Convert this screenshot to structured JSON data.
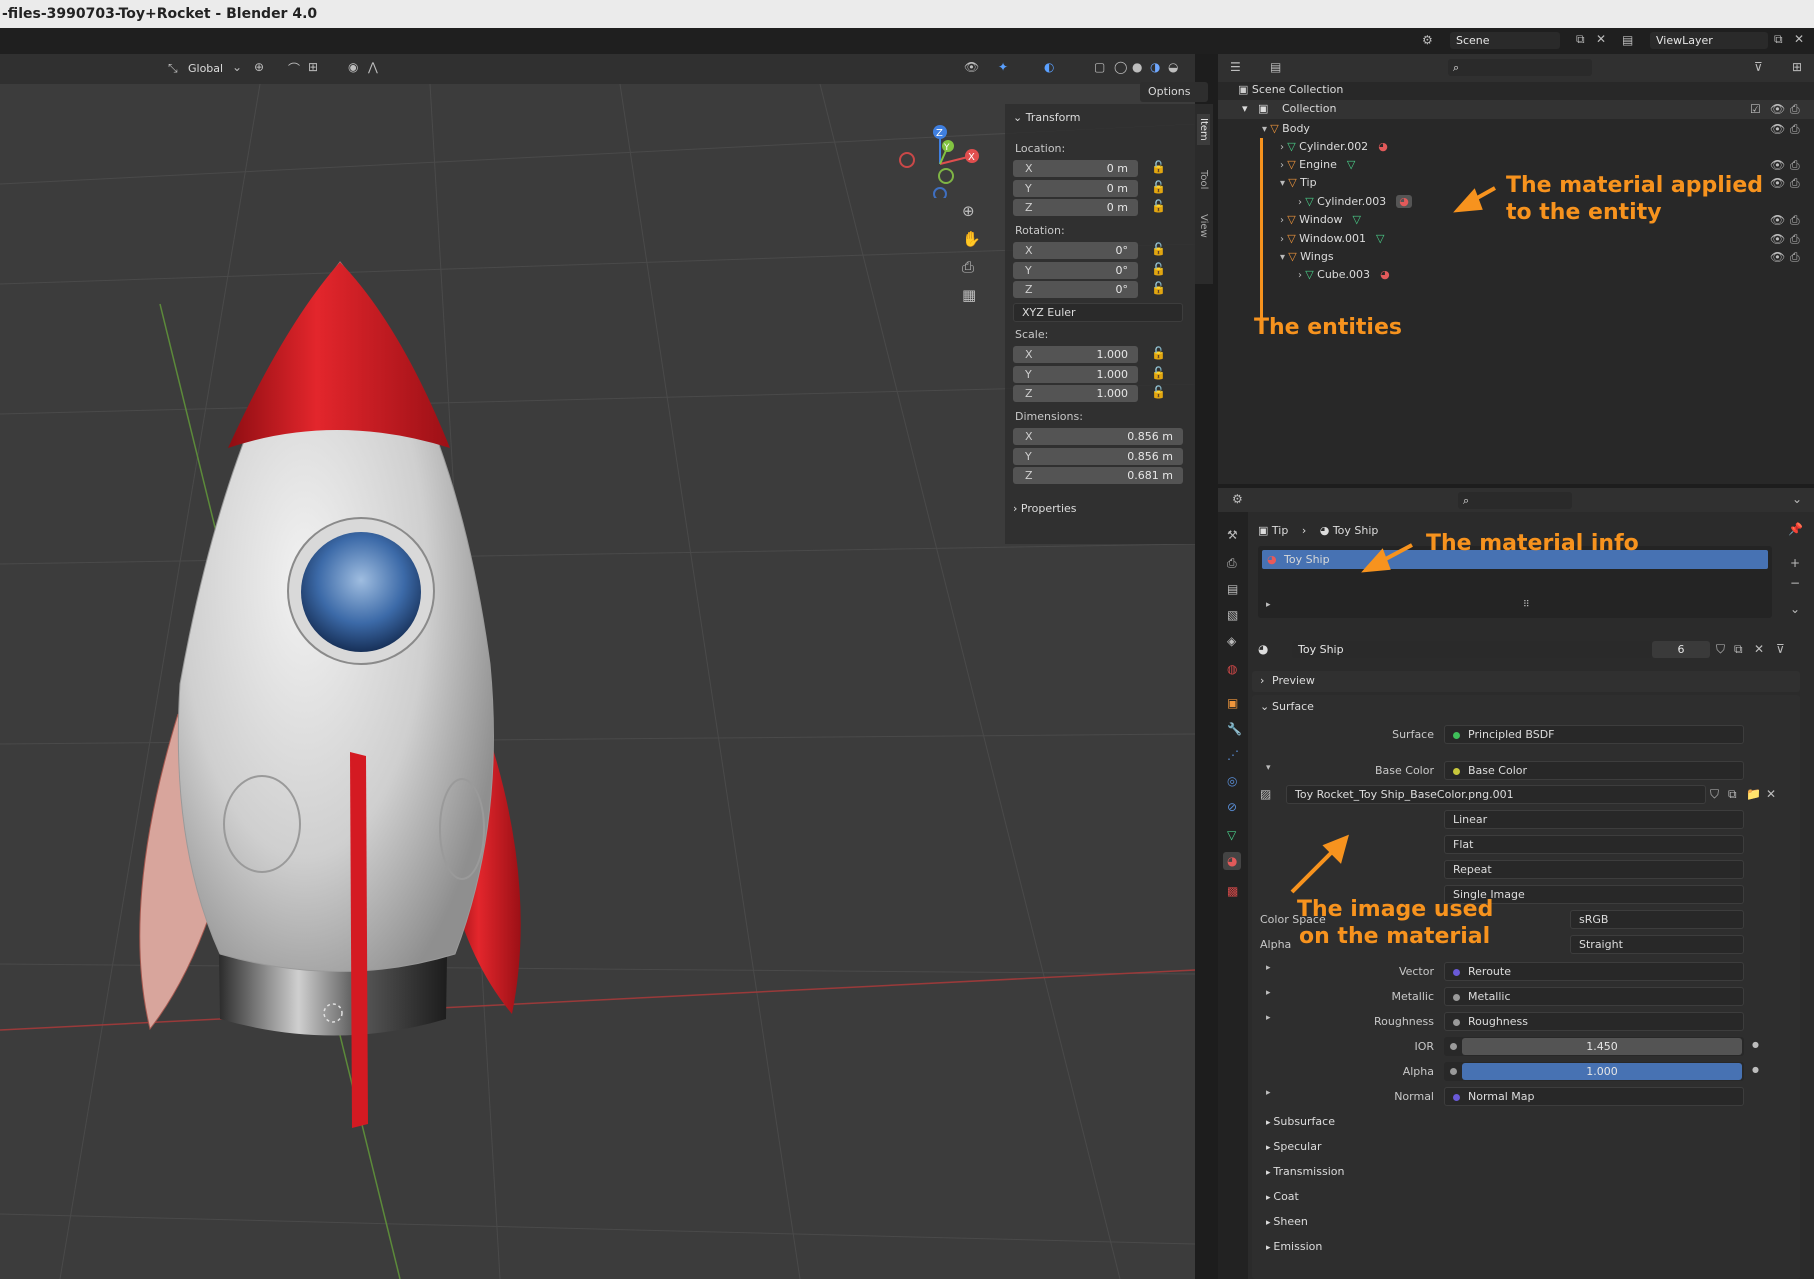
{
  "window": {
    "title": "-files-3990703-Toy+Rocket - Blender 4.0"
  },
  "topbar": {
    "scene_label": "Scene",
    "viewlayer_label": "ViewLayer"
  },
  "viewport_header": {
    "orientation": "Global",
    "options_label": "Options"
  },
  "transform_panel": {
    "title": "Transform",
    "location_label": "Location:",
    "location": [
      {
        "axis": "X",
        "value": "0 m"
      },
      {
        "axis": "Y",
        "value": "0 m"
      },
      {
        "axis": "Z",
        "value": "0 m"
      }
    ],
    "rotation_label": "Rotation:",
    "rotation": [
      {
        "axis": "X",
        "value": "0°"
      },
      {
        "axis": "Y",
        "value": "0°"
      },
      {
        "axis": "Z",
        "value": "0°"
      }
    ],
    "rotation_mode": "XYZ Euler",
    "scale_label": "Scale:",
    "scale": [
      {
        "axis": "X",
        "value": "1.000"
      },
      {
        "axis": "Y",
        "value": "1.000"
      },
      {
        "axis": "Z",
        "value": "1.000"
      }
    ],
    "dimensions_label": "Dimensions:",
    "dimensions": [
      {
        "axis": "X",
        "value": "0.856 m"
      },
      {
        "axis": "Y",
        "value": "0.856 m"
      },
      {
        "axis": "Z",
        "value": "0.681 m"
      }
    ],
    "properties_label": "Properties"
  },
  "side_tabs": [
    "Item",
    "Tool",
    "View"
  ],
  "outliner": {
    "scene_collection": "Scene Collection",
    "collection": "Collection",
    "items": [
      {
        "name": "Body",
        "kind": "object"
      },
      {
        "name": "Cylinder.002",
        "kind": "mesh"
      },
      {
        "name": "Engine",
        "kind": "object"
      },
      {
        "name": "Tip",
        "kind": "object"
      },
      {
        "name": "Cylinder.003",
        "kind": "mesh"
      },
      {
        "name": "Window",
        "kind": "object"
      },
      {
        "name": "Window.001",
        "kind": "object"
      },
      {
        "name": "Wings",
        "kind": "object"
      },
      {
        "name": "Cube.003",
        "kind": "mesh"
      }
    ]
  },
  "properties": {
    "breadcrumb_object": "Tip",
    "breadcrumb_material": "Toy Ship",
    "material_slot": "Toy Ship",
    "material_name": "Toy Ship",
    "user_count": "6",
    "preview_label": "Preview",
    "surface_header": "Surface",
    "surface_label": "Surface",
    "surface_value": "Principled BSDF",
    "base_color_label": "Base Color",
    "base_color_value": "Base Color",
    "image_name": "Toy Rocket_Toy Ship_BaseColor.png.001",
    "interpolation": "Linear",
    "projection": "Flat",
    "extension": "Repeat",
    "source": "Single Image",
    "color_space_label": "Color Space",
    "color_space_value": "sRGB",
    "alpha_label": "Alpha",
    "alpha_value": "Straight",
    "inputs": [
      {
        "label": "Vector",
        "value": "Reroute"
      },
      {
        "label": "Metallic",
        "value": "Metallic"
      },
      {
        "label": "Roughness",
        "value": "Roughness"
      }
    ],
    "ior_label": "IOR",
    "ior_value": "1.450",
    "alpha_in_label": "Alpha",
    "alpha_in_value": "1.000",
    "normal_label": "Normal",
    "normal_value": "Normal Map",
    "sections": [
      "Subsurface",
      "Specular",
      "Transmission",
      "Coat",
      "Sheen",
      "Emission"
    ]
  },
  "annotations": {
    "material_applied": [
      "The material applied",
      "to the entity"
    ],
    "entities": "The entities",
    "material_info": "The material info",
    "image_used": [
      "The image used",
      "on the material"
    ]
  },
  "colors": {
    "annotation": "#f7931e",
    "selection": "#4772b3",
    "rocket_red": "#c8141c"
  }
}
